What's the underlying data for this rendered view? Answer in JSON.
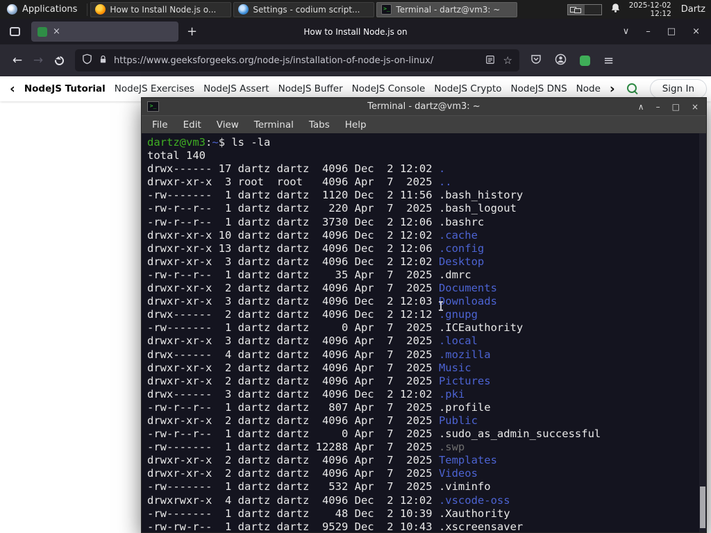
{
  "colors": {
    "accent_green": "#2f8d46",
    "dir_blue": "#4c63d2",
    "prompt_green": "#3fae23",
    "terminal_bg": "#14141f",
    "terminal_fg": "#e8e8e8",
    "dim_gray": "#6e6e6e"
  },
  "icons": {
    "back": "←",
    "forward": "→",
    "close": "×",
    "minimize": "–",
    "maximize": "□",
    "shade": "∧",
    "new_tab": "+",
    "tab_list": "∨",
    "menu": "≡",
    "star": "☆",
    "nav_prev": "‹",
    "nav_next": "›",
    "terminal_glyph": ">_"
  },
  "taskbar": {
    "applications_label": "Applications",
    "windows": [
      {
        "label": "How to Install Node.js o...",
        "icon": "firefox"
      },
      {
        "label": "Settings - codium script...",
        "icon": "settings"
      },
      {
        "label": "Terminal - dartz@vm3: ~",
        "icon": "terminal",
        "active": true
      }
    ],
    "clock_date": "2025-12-02",
    "clock_time": "12:12",
    "username": "Dartz"
  },
  "browser": {
    "tab_title": "How to Install Node.js on",
    "url": "https://www.geeksforgeeks.org/node-js/installation-of-node-js-on-linux/",
    "nav_links": [
      "NodeJS Tutorial",
      "NodeJS Exercises",
      "NodeJS Assert",
      "NodeJS Buffer",
      "NodeJS Console",
      "NodeJS Crypto",
      "NodeJS DNS",
      "Node"
    ],
    "sign_in_label": "Sign In"
  },
  "terminal": {
    "title": "Terminal - dartz@vm3: ~",
    "menu": [
      "File",
      "Edit",
      "View",
      "Terminal",
      "Tabs",
      "Help"
    ],
    "prompt_user": "dartz@vm3",
    "prompt_sep": ":",
    "prompt_path": "~",
    "prompt_cmd": "$ ls -la",
    "total_line": "total 140",
    "lines": [
      {
        "pre": "drwx------ 17 dartz dartz  4096 Dec  2 12:02 ",
        "name": ".",
        "type": "dir"
      },
      {
        "pre": "drwxr-xr-x  3 root  root   4096 Apr  7  2025 ",
        "name": "..",
        "type": "dir"
      },
      {
        "pre": "-rw-------  1 dartz dartz  1120 Dec  2 11:56 ",
        "name": ".bash_history",
        "type": "file"
      },
      {
        "pre": "-rw-r--r--  1 dartz dartz   220 Apr  7  2025 ",
        "name": ".bash_logout",
        "type": "file"
      },
      {
        "pre": "-rw-r--r--  1 dartz dartz  3730 Dec  2 12:06 ",
        "name": ".bashrc",
        "type": "file"
      },
      {
        "pre": "drwxr-xr-x 10 dartz dartz  4096 Dec  2 12:02 ",
        "name": ".cache",
        "type": "dir"
      },
      {
        "pre": "drwxr-xr-x 13 dartz dartz  4096 Dec  2 12:06 ",
        "name": ".config",
        "type": "dir"
      },
      {
        "pre": "drwxr-xr-x  3 dartz dartz  4096 Dec  2 12:02 ",
        "name": "Desktop",
        "type": "dir"
      },
      {
        "pre": "-rw-r--r--  1 dartz dartz    35 Apr  7  2025 ",
        "name": ".dmrc",
        "type": "file"
      },
      {
        "pre": "drwxr-xr-x  2 dartz dartz  4096 Apr  7  2025 ",
        "name": "Documents",
        "type": "dir"
      },
      {
        "pre": "drwxr-xr-x  3 dartz dartz  4096 Dec  2 12:03 ",
        "name": "Downloads",
        "type": "dir"
      },
      {
        "pre": "drwx------  2 dartz dartz  4096 Dec  2 12:12 ",
        "name": ".gnupg",
        "type": "dir"
      },
      {
        "pre": "-rw-------  1 dartz dartz     0 Apr  7  2025 ",
        "name": ".ICEauthority",
        "type": "file"
      },
      {
        "pre": "drwxr-xr-x  3 dartz dartz  4096 Apr  7  2025 ",
        "name": ".local",
        "type": "dir"
      },
      {
        "pre": "drwx------  4 dartz dartz  4096 Apr  7  2025 ",
        "name": ".mozilla",
        "type": "dir"
      },
      {
        "pre": "drwxr-xr-x  2 dartz dartz  4096 Apr  7  2025 ",
        "name": "Music",
        "type": "dir"
      },
      {
        "pre": "drwxr-xr-x  2 dartz dartz  4096 Apr  7  2025 ",
        "name": "Pictures",
        "type": "dir"
      },
      {
        "pre": "drwx------  3 dartz dartz  4096 Dec  2 12:02 ",
        "name": ".pki",
        "type": "dir"
      },
      {
        "pre": "-rw-r--r--  1 dartz dartz   807 Apr  7  2025 ",
        "name": ".profile",
        "type": "file"
      },
      {
        "pre": "drwxr-xr-x  2 dartz dartz  4096 Apr  7  2025 ",
        "name": "Public",
        "type": "dir"
      },
      {
        "pre": "-rw-r--r--  1 dartz dartz     0 Apr  7  2025 ",
        "name": ".sudo_as_admin_successful",
        "type": "file"
      },
      {
        "pre": "-rw-------  1 dartz dartz 12288 Apr  7  2025 ",
        "name": ".swp",
        "type": "dim"
      },
      {
        "pre": "drwxr-xr-x  2 dartz dartz  4096 Apr  7  2025 ",
        "name": "Templates",
        "type": "dir"
      },
      {
        "pre": "drwxr-xr-x  2 dartz dartz  4096 Apr  7  2025 ",
        "name": "Videos",
        "type": "dir"
      },
      {
        "pre": "-rw-------  1 dartz dartz   532 Apr  7  2025 ",
        "name": ".viminfo",
        "type": "file"
      },
      {
        "pre": "drwxrwxr-x  4 dartz dartz  4096 Dec  2 12:02 ",
        "name": ".vscode-oss",
        "type": "dir"
      },
      {
        "pre": "-rw-------  1 dartz dartz    48 Dec  2 10:39 ",
        "name": ".Xauthority",
        "type": "file"
      },
      {
        "pre": "-rw-rw-r--  1 dartz dartz  9529 Dec  2 10:43 ",
        "name": ".xscreensaver",
        "type": "file"
      }
    ]
  }
}
